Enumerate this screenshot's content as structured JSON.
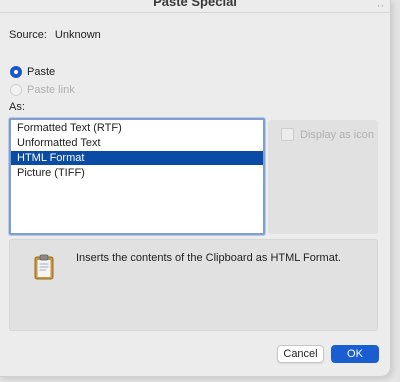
{
  "dialog": {
    "title": "Paste Special",
    "source_label": "Source:",
    "source_value": "Unknown"
  },
  "options": {
    "paste_label": "Paste",
    "paste_link_label": "Paste link"
  },
  "as_label": "As:",
  "formats": [
    {
      "label": "Formatted Text (RTF)"
    },
    {
      "label": "Unformatted Text"
    },
    {
      "label": "HTML Format"
    },
    {
      "label": "Picture (TIFF)"
    }
  ],
  "selected_format": "HTML Format",
  "display_as_icon_label": "Display as icon",
  "result": {
    "icon": "clipboard-icon",
    "text": "Inserts the contents of the Clipboard as HTML Format."
  },
  "buttons": {
    "cancel_label": "Cancel",
    "ok_label": "OK"
  },
  "colors": {
    "accent": "#1a5dd1",
    "selection": "#0a4ba6"
  }
}
